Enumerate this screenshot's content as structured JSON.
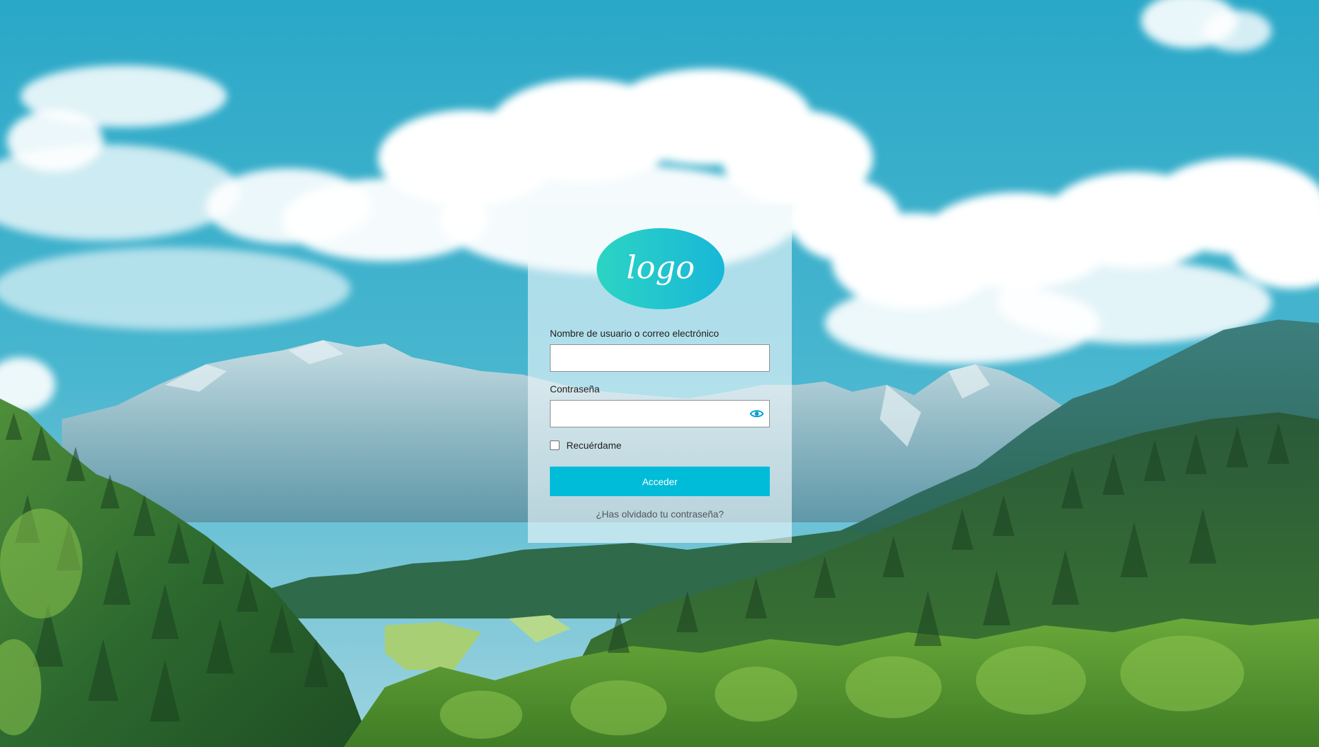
{
  "background": {
    "description_icon": "mountain-landscape",
    "colors": {
      "sky": "#2aa9c6",
      "cloud": "#ffffff",
      "mountain": "#8fb8c4",
      "forest_dark": "#1f4a2a",
      "forest_light": "#6fae3a"
    }
  },
  "login": {
    "logo_text": "logo",
    "logo_colors": [
      "#2cd4c3",
      "#18b7d8"
    ],
    "username_label": "Nombre de usuario o correo electrónico",
    "username_value": "",
    "password_label": "Contraseña",
    "password_value": "",
    "show_password_icon": "eye-icon",
    "remember_label": "Recuérdame",
    "remember_checked": false,
    "submit_label": "Acceder",
    "forgot_label": "¿Has olvidado tu contraseña?",
    "accent_color": "#00bcd9"
  }
}
